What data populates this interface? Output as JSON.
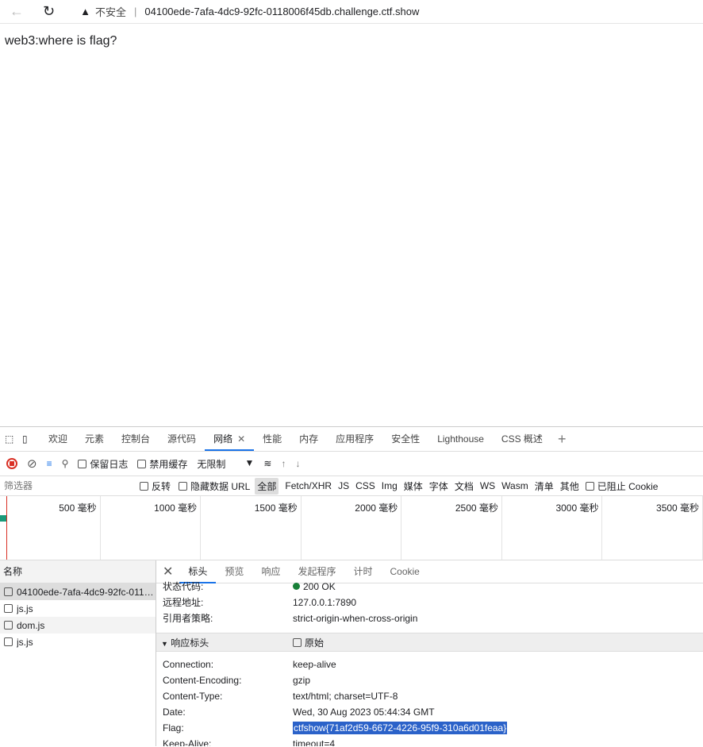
{
  "browser": {
    "security_label": "不安全",
    "url": "04100ede-7afa-4dc9-92fc-0118006f45db.challenge.ctf.show"
  },
  "page": {
    "text": "web3:where is flag?"
  },
  "devtools": {
    "tabs": [
      "欢迎",
      "元素",
      "控制台",
      "源代码",
      "网络",
      "性能",
      "内存",
      "应用程序",
      "安全性",
      "Lighthouse",
      "CSS 概述"
    ],
    "active_tab": "网络",
    "toolbar": {
      "preserve_log": "保留日志",
      "disable_cache": "禁用缓存",
      "throttle": "无限制"
    },
    "filter": {
      "placeholder": "筛选器",
      "invert": "反转",
      "hide_data_urls": "隐藏数据 URL",
      "types": [
        "全部",
        "Fetch/XHR",
        "JS",
        "CSS",
        "Img",
        "媒体",
        "字体",
        "文档",
        "WS",
        "Wasm",
        "清单",
        "其他"
      ],
      "blocked_cookies": "已阻止 Cookie"
    },
    "timeline": [
      "500 毫秒",
      "1000 毫秒",
      "1500 毫秒",
      "2000 毫秒",
      "2500 毫秒",
      "3000 毫秒",
      "3500 毫秒"
    ],
    "requests_header": "名称",
    "requests": [
      "04100ede-7afa-4dc9-92fc-011…",
      "js.js",
      "dom.js",
      "js.js"
    ],
    "detail_tabs": [
      "标头",
      "预览",
      "响应",
      "发起程序",
      "计时",
      "Cookie"
    ],
    "general": [
      {
        "k": "状态代码:",
        "v": "200 OK"
      },
      {
        "k": "远程地址:",
        "v": "127.0.0.1:7890"
      },
      {
        "k": "引用者策略:",
        "v": "strict-origin-when-cross-origin"
      }
    ],
    "response_headers_title": "响应标头",
    "raw_label": "原始",
    "response_headers": [
      {
        "k": "Connection:",
        "v": "keep-alive"
      },
      {
        "k": "Content-Encoding:",
        "v": "gzip"
      },
      {
        "k": "Content-Type:",
        "v": "text/html; charset=UTF-8"
      },
      {
        "k": "Date:",
        "v": "Wed, 30 Aug 2023 05:44:34 GMT"
      },
      {
        "k": "Flag:",
        "v": "ctfshow{71af2d59-6672-4226-95f9-310a6d01feaa}"
      },
      {
        "k": "Keep-Alive:",
        "v": "timeout=4"
      }
    ]
  }
}
